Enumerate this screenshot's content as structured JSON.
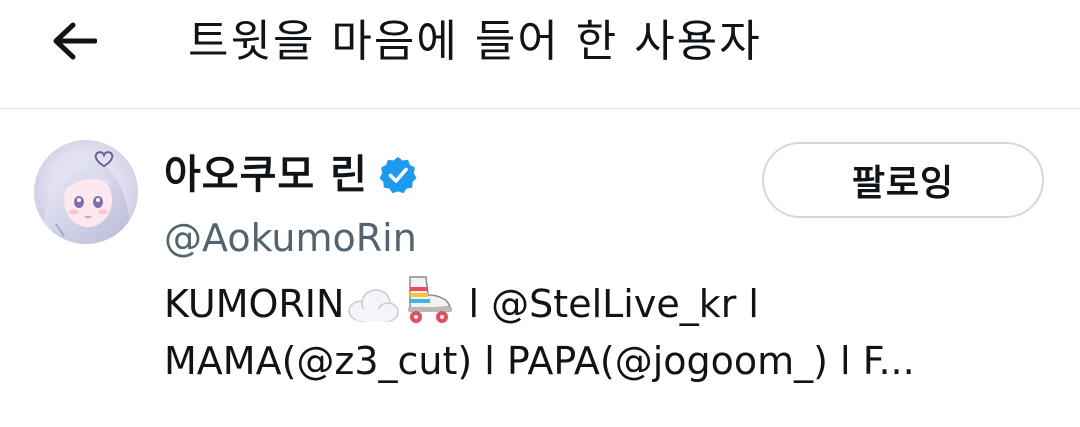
{
  "header": {
    "back_icon": "arrow-left-icon",
    "title": "트윗을 마음에 들어 한 사용자"
  },
  "user": {
    "display_name": "아오쿠모 린",
    "verified": true,
    "verified_color": "#1d9bf0",
    "handle": "@AokumoRin",
    "follow_button_label": "팔로잉",
    "bio": {
      "line1_prefix": "KUMORIN",
      "line1_emojis": [
        "cloud-emoji",
        "roller-skate-emoji"
      ],
      "line1_suffix": " l @StelLive_kr l",
      "line2": "MAMA(@z3_cut) l PAPA(@jogoom_) l F..."
    }
  }
}
